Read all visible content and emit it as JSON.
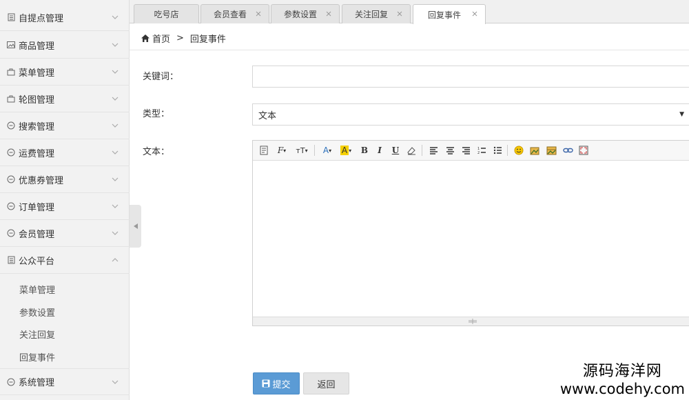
{
  "sidebar": {
    "items": [
      {
        "label": "自提点管理",
        "icon": "document-icon",
        "expanded": false
      },
      {
        "label": "商品管理",
        "icon": "image-icon",
        "expanded": false
      },
      {
        "label": "菜单管理",
        "icon": "bag-icon",
        "expanded": false
      },
      {
        "label": "轮图管理",
        "icon": "bag-icon",
        "expanded": false
      },
      {
        "label": "搜索管理",
        "icon": "chat-icon",
        "expanded": false
      },
      {
        "label": "运费管理",
        "icon": "chat-icon",
        "expanded": false
      },
      {
        "label": "优惠券管理",
        "icon": "chat-icon",
        "expanded": false
      },
      {
        "label": "订单管理",
        "icon": "chat-icon",
        "expanded": false
      },
      {
        "label": "会员管理",
        "icon": "chat-icon",
        "expanded": false
      },
      {
        "label": "公众平台",
        "icon": "document-icon",
        "expanded": true
      },
      {
        "label": "系统管理",
        "icon": "chat-icon",
        "expanded": false
      }
    ],
    "submenu": [
      "菜单管理",
      "参数设置",
      "关注回复",
      "回复事件"
    ]
  },
  "tabs": [
    {
      "label": "吃号店",
      "closable": false,
      "active": false
    },
    {
      "label": "会员查看",
      "closable": true,
      "active": false
    },
    {
      "label": "参数设置",
      "closable": true,
      "active": false
    },
    {
      "label": "关注回复",
      "closable": true,
      "active": false
    },
    {
      "label": "回复事件",
      "closable": true,
      "active": true
    }
  ],
  "breadcrumb": {
    "home": "首页",
    "separator": ">",
    "current": "回复事件"
  },
  "form": {
    "keyword_label": "关键词：",
    "keyword_value": "",
    "type_label": "类型：",
    "type_value": "文本",
    "text_label": "文本："
  },
  "buttons": {
    "submit": "提交",
    "back": "返回"
  },
  "watermark": {
    "name": "源码海洋网",
    "url": "www.codehy.com"
  },
  "colors": {
    "primary": "#5b9bd5",
    "sidebar_bg": "#f2f2f2",
    "tab_bg": "#e4e4e4"
  }
}
